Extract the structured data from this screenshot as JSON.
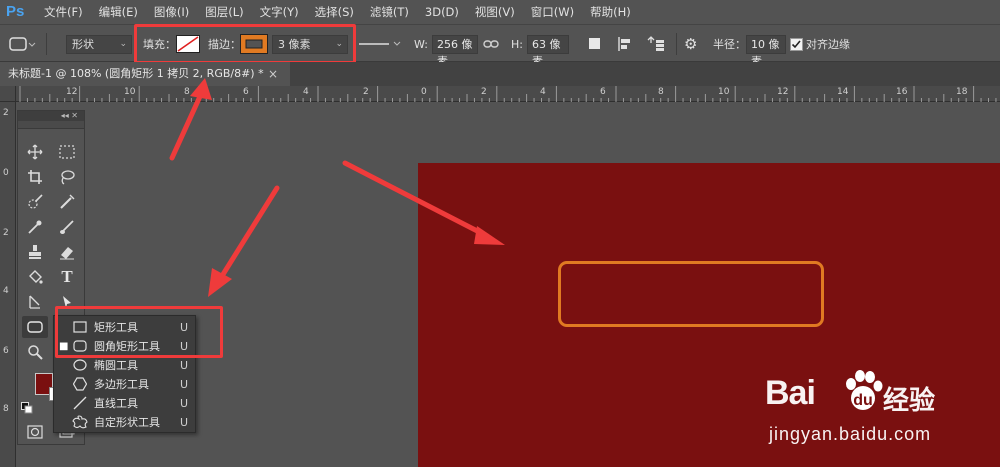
{
  "app": {
    "logo": "Ps"
  },
  "menubar": {
    "items": [
      "文件(F)",
      "编辑(E)",
      "图像(I)",
      "图层(L)",
      "文字(Y)",
      "选择(S)",
      "滤镜(T)",
      "3D(D)",
      "视图(V)",
      "窗口(W)",
      "帮助(H)"
    ]
  },
  "options": {
    "mode_value": "形状",
    "fill_label": "填充：",
    "stroke_label": "描边：",
    "stroke_width_value": "3 像素",
    "w_label": "W:",
    "w_value": "256 像素",
    "h_label": "H:",
    "h_value": "63 像素",
    "radius_label": "半径：",
    "radius_value": "10 像素",
    "align_edges_label": "对齐边缘",
    "align_edges_checked": true,
    "stroke_color": "#e07a22"
  },
  "document": {
    "tab_title": "未标题-1 @ 108% (圆角矩形 1 拷贝 2, RGB/8#) *",
    "close_glyph": "×",
    "canvas_color": "#7a1010"
  },
  "rulers": {
    "top_labels": [
      "12",
      "10",
      "8",
      "6",
      "4",
      "2",
      "0",
      "2",
      "4",
      "6",
      "8",
      "10",
      "12",
      "14",
      "16",
      "18"
    ],
    "left_labels": [
      "2",
      "0",
      "2",
      "4",
      "6",
      "8"
    ]
  },
  "toolbox": {
    "collapse_glyph": "◂◂  ✕",
    "foreground_color": "#7a1010",
    "background_color": "#ffffff"
  },
  "flyout": {
    "items": [
      {
        "label": "矩形工具",
        "shortcut": "U",
        "icon": "rectangle-icon",
        "selected": false
      },
      {
        "label": "圆角矩形工具",
        "shortcut": "U",
        "icon": "rounded-rectangle-icon",
        "selected": true
      },
      {
        "label": "椭圆工具",
        "shortcut": "U",
        "icon": "ellipse-icon",
        "selected": false
      },
      {
        "label": "多边形工具",
        "shortcut": "U",
        "icon": "polygon-icon",
        "selected": false
      },
      {
        "label": "直线工具",
        "shortcut": "U",
        "icon": "line-icon",
        "selected": false
      },
      {
        "label": "自定形状工具",
        "shortcut": "U",
        "icon": "custom-shape-icon",
        "selected": false
      }
    ]
  },
  "watermark": {
    "logo_text": "Bai",
    "logo_suffix": "经验",
    "url": "jingyan.baidu.com"
  },
  "annotation_color": "#ef3b3b"
}
